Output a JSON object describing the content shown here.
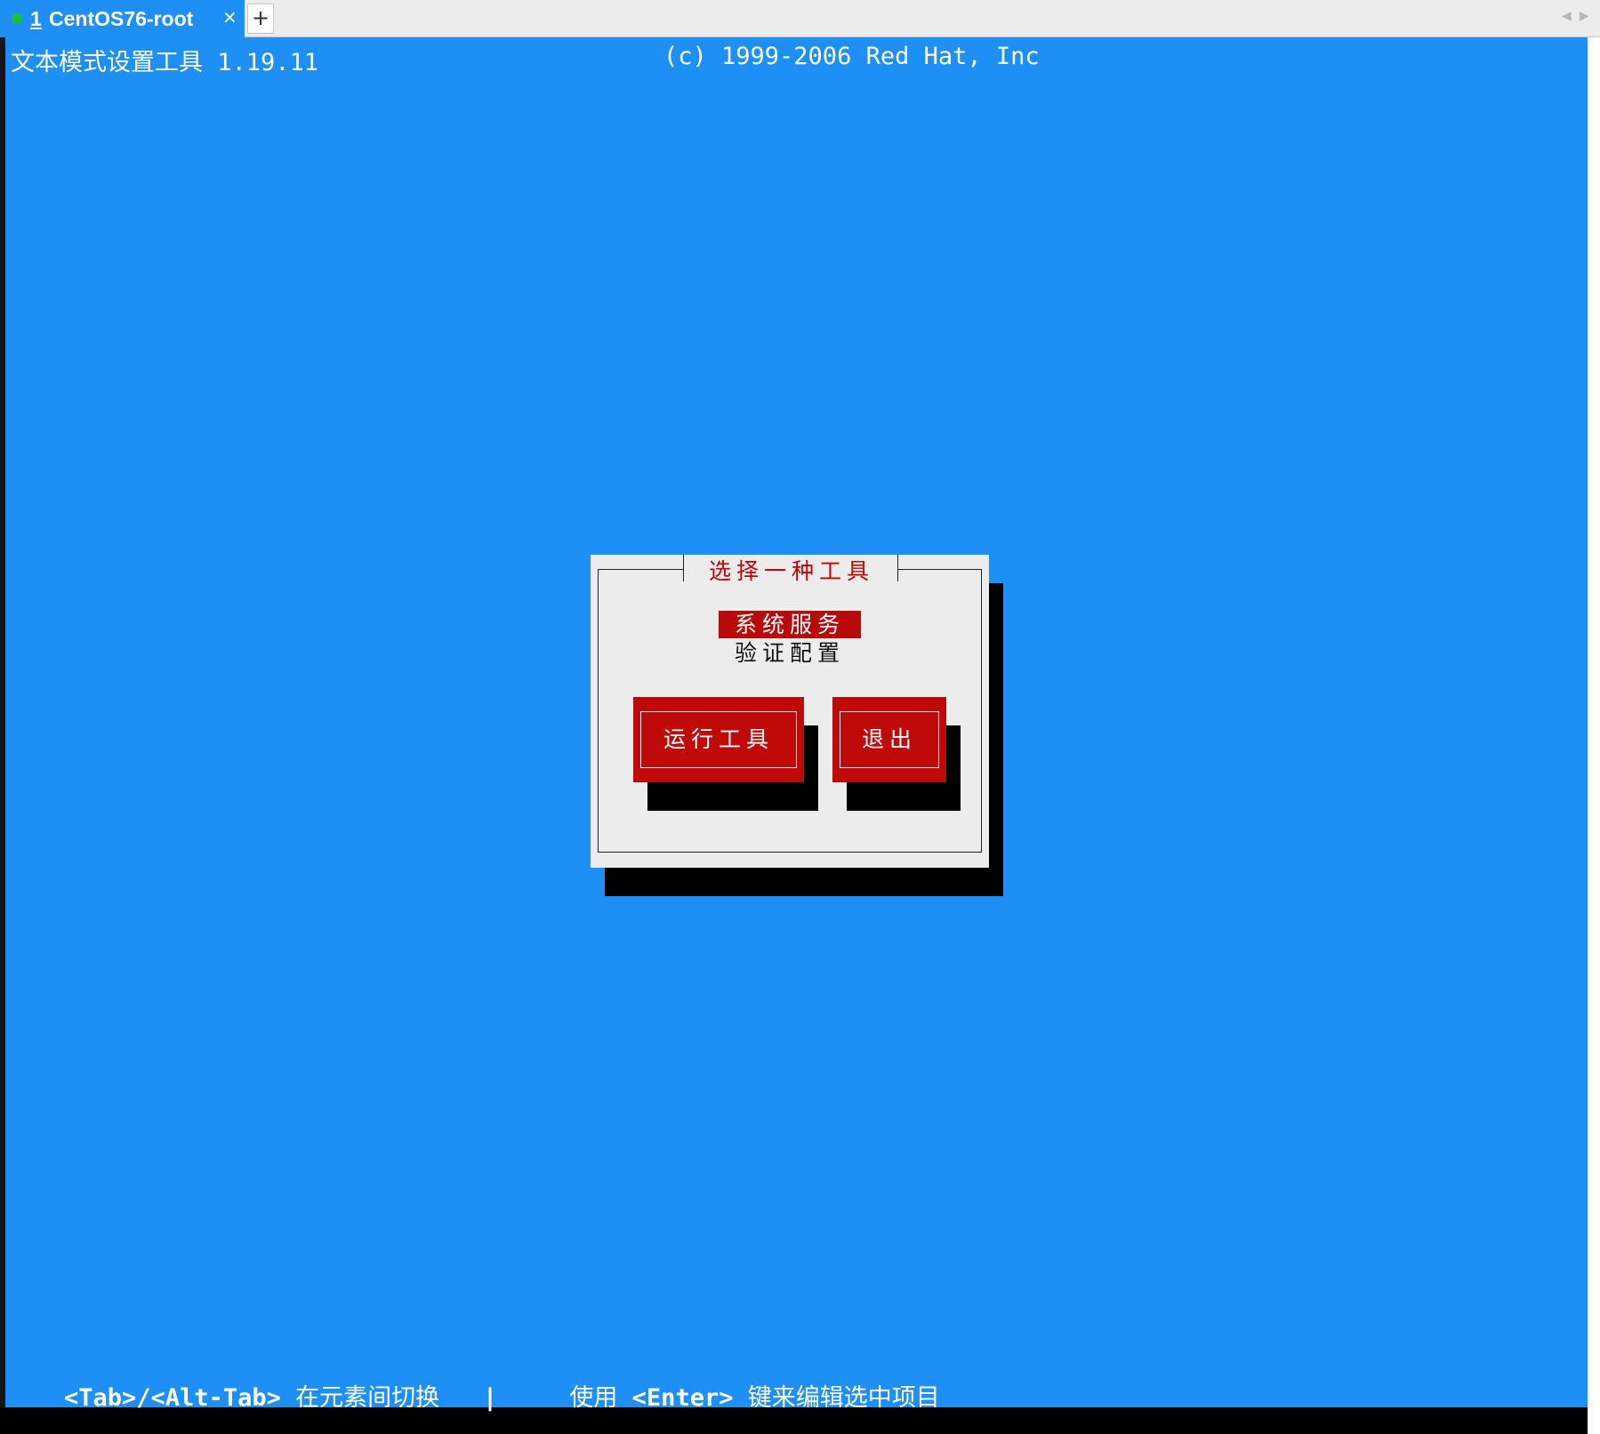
{
  "tab": {
    "number": "1",
    "title": "CentOS76-root",
    "close_glyph": "×",
    "add_glyph": "+",
    "status_color": "#19c23a"
  },
  "terminal": {
    "header_left": "文本模式设置工具 1.19.11",
    "header_right": "(c) 1999-2006 Red Hat, Inc",
    "background_color": "#1e90f5"
  },
  "dialog": {
    "title": "选择一种工具",
    "menu_items": [
      {
        "label": "系统服务",
        "selected": true
      },
      {
        "label": "验证配置",
        "selected": false
      }
    ],
    "buttons": {
      "run": "运行工具",
      "quit": "退出"
    },
    "accent_color": "#c00a0a"
  },
  "hint": {
    "tab_keys": "<Tab>/<Alt-Tab>",
    "tab_desc": " 在元素间切换 ",
    "separator": "  |     ",
    "use": "使用 ",
    "enter_key": "<Enter>",
    "enter_desc": " 键来编辑选中项目"
  }
}
